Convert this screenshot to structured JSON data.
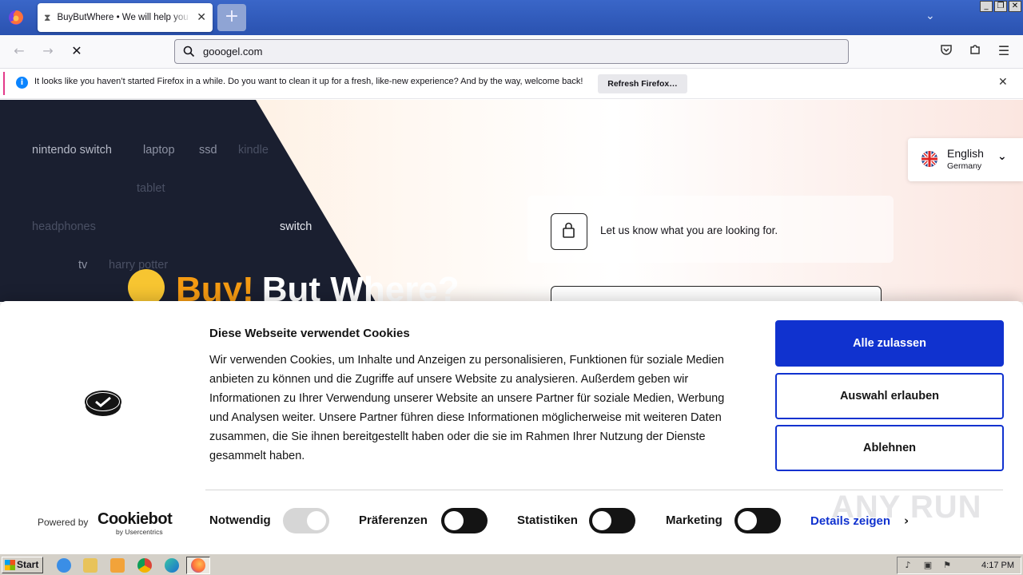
{
  "browser": {
    "tab_title": "BuyButWhere • We will help you to find",
    "new_tab_symbol": "+",
    "url": "gooogel.com",
    "notification": {
      "text": "It looks like you haven’t started Firefox in a while. Do you want to clean it up for a fresh, like-new experience? And by the way, welcome back!",
      "button_label": "Refresh Firefox…"
    }
  },
  "page": {
    "tags": [
      "nintendo switch",
      "laptop",
      "ssd",
      "kindle",
      "tablet",
      "headphones",
      "switch",
      "tv",
      "harry potter"
    ],
    "hero": {
      "word1": "Buy!",
      "word2": "But Where?"
    },
    "language": {
      "name": "English",
      "region": "Germany"
    },
    "prompt": "Let us know what you are looking for."
  },
  "cookie_dialog": {
    "title": "Diese Webseite verwendet Cookies",
    "body": "Wir verwenden Cookies, um Inhalte und Anzeigen zu personalisieren, Funktionen für soziale Medien anbieten zu können und die Zugriffe auf unsere Website zu analysieren. Außerdem geben wir Informationen zu Ihrer Verwendung unserer Website an unsere Partner für soziale Medien, Werbung und Analysen weiter. Unsere Partner führen diese Informationen möglicherweise mit weiteren Daten zusammen, die Sie ihnen bereitgestellt haben oder die sie im Rahmen Ihrer Nutzung der Dienste gesammelt haben.",
    "buttons": {
      "allow_all": "Alle zulassen",
      "allow_selection": "Auswahl erlauben",
      "deny": "Ablehnen"
    },
    "powered_by": "Powered by",
    "brand": "Cookiebot",
    "brand_sub": "by Usercentrics",
    "toggles": [
      {
        "label": "Notwendig",
        "on": true,
        "disabled": true
      },
      {
        "label": "Präferenzen",
        "on": false
      },
      {
        "label": "Statistiken",
        "on": false
      },
      {
        "label": "Marketing",
        "on": false
      }
    ],
    "details_label": "Details zeigen"
  },
  "watermark": "ANY RUN",
  "taskbar": {
    "start_label": "Start",
    "clock": "4:17 PM"
  },
  "colors": {
    "accent_blue": "#1032cf",
    "hero_orange": "#f49a12",
    "dark_panel": "#1a1f30"
  }
}
